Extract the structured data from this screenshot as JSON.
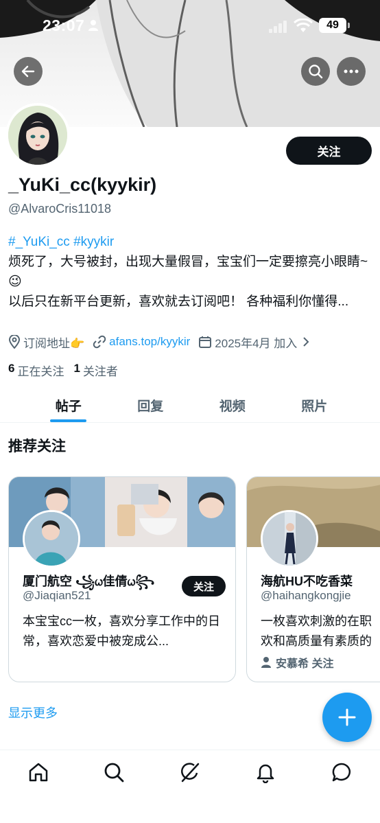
{
  "status": {
    "time": "23:07",
    "battery": "49"
  },
  "profile": {
    "display_name": "_YuKi_cc(kyykir)",
    "handle": "@AlvaroCris11018",
    "follow_label": "关注",
    "bio_tags": "#_YuKi_cc #kyykir",
    "bio_line1": "烦死了，大号被封，出现大量假冒，宝宝们一定要擦亮小眼睛~😉",
    "bio_line2": "以后只在新平台更新，喜欢就去订阅吧！ 各种福利你懂得...",
    "location": "订阅地址👉",
    "website": "afans.top/kyykir",
    "joined": "2025年4月 加入",
    "following_count": "6",
    "following_label": "正在关注",
    "followers_count": "1",
    "followers_label": "关注者"
  },
  "tabs": [
    {
      "label": "帖子",
      "active": true
    },
    {
      "label": "回复",
      "active": false
    },
    {
      "label": "视频",
      "active": false
    },
    {
      "label": "照片",
      "active": false
    }
  ],
  "recommended": {
    "title": "推荐关注",
    "cards": [
      {
        "name": "厦门航空 ꧁ᤐ佳倩ᤐ꧂",
        "handle": "@Jiaqian521",
        "desc": "本宝宝cc一枚，喜欢分享工作中的日常，喜欢恋爱中被宠成公...",
        "follow_label": "关注"
      },
      {
        "name": "海航HU不吃香菜",
        "handle": "@haihangkongjie",
        "desc_line1": "一枚喜欢刺激的在职",
        "desc_line2": "欢和高质量有素质的",
        "followed_by": "安慕希 关注"
      }
    ],
    "show_more": "显示更多"
  },
  "icons": {
    "back": "arrow-left-icon",
    "search": "search-icon",
    "more": "more-icon",
    "location": "location-pin-icon",
    "link": "link-icon",
    "calendar": "calendar-icon",
    "compose": "plus-icon",
    "nav": [
      "home-icon",
      "search-icon",
      "grok-icon",
      "bell-icon",
      "message-icon"
    ]
  },
  "colors": {
    "accent": "#1d9bf0",
    "text": "#0f1419",
    "secondary": "#536471"
  }
}
